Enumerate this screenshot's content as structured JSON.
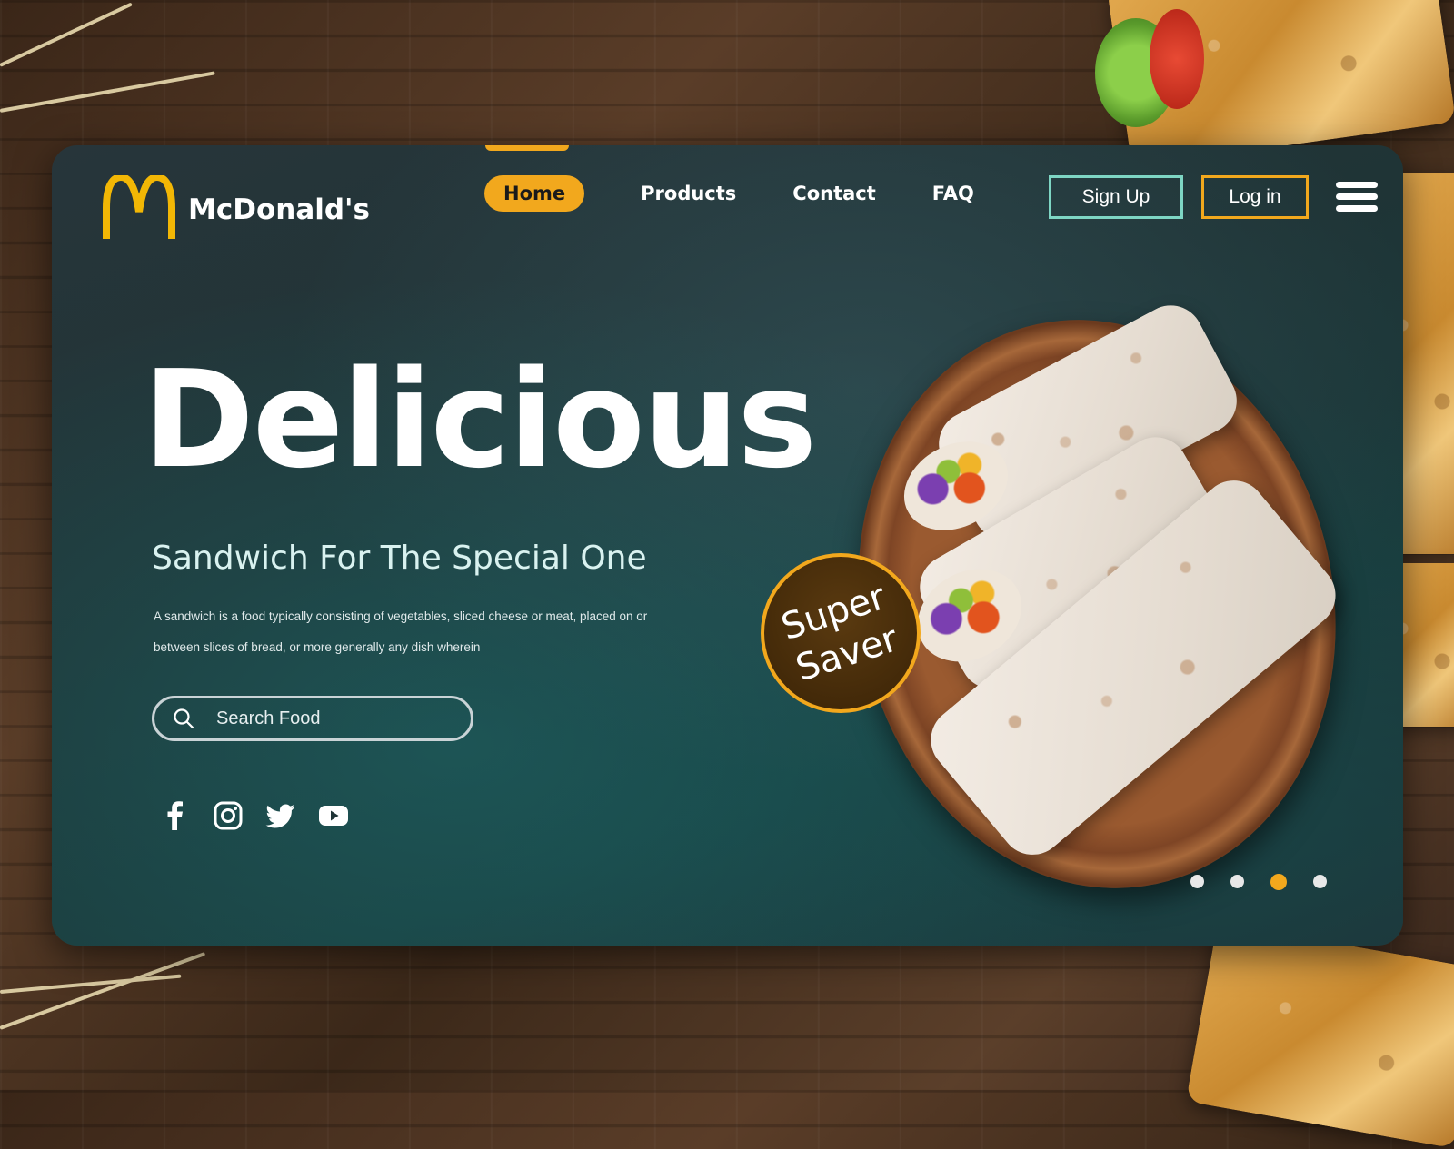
{
  "brand": {
    "name": "McDonald's",
    "logo_icon": "golden-arches-logo",
    "accent_color": "#f2a81d"
  },
  "nav": {
    "items": [
      {
        "label": "Home",
        "active": true
      },
      {
        "label": "Products",
        "active": false
      },
      {
        "label": "Contact",
        "active": false
      },
      {
        "label": "FAQ",
        "active": false
      }
    ]
  },
  "auth": {
    "signup_label": "Sign Up",
    "login_label": "Log in",
    "menu_icon": "hamburger-menu-icon"
  },
  "hero": {
    "title": "Delicious",
    "subtitle": "Sandwich For The Special One",
    "description_line1": "A sandwich is a food typically consisting of vegetables, sliced cheese or meat, placed on or",
    "description_line2": "between slices of bread, or more generally any dish wherein"
  },
  "search": {
    "placeholder": "Search Food",
    "icon": "search-icon"
  },
  "socials": [
    {
      "icon": "facebook-icon"
    },
    {
      "icon": "instagram-icon"
    },
    {
      "icon": "twitter-icon"
    },
    {
      "icon": "youtube-icon"
    }
  ],
  "badge": {
    "line1": "Super",
    "line2": "Saver"
  },
  "slider": {
    "total": 4,
    "active_index": 2
  }
}
